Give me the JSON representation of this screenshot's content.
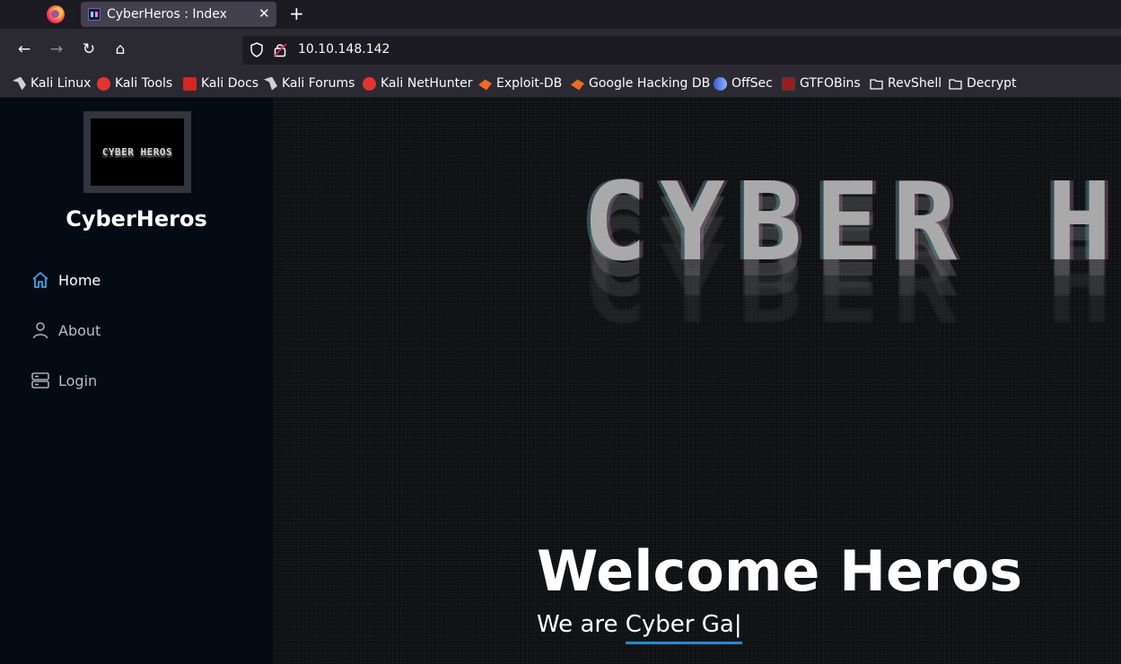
{
  "browser": {
    "tab": {
      "title": "CyberHeros : Index",
      "close_glyph": "✕"
    },
    "new_tab_glyph": "+",
    "nav": {
      "back": "←",
      "forward": "→",
      "reload": "↻",
      "home": "⌂"
    },
    "url": "10.10.148.142",
    "bookmarks": [
      {
        "label": "Kali Linux",
        "icon": "kali-dragon-icon",
        "color": "#d0d0d0"
      },
      {
        "label": "Kali Tools",
        "icon": "kali-tools-icon",
        "color": "#e5342f"
      },
      {
        "label": "Kali Docs",
        "icon": "kali-docs-icon",
        "color": "#d6261f"
      },
      {
        "label": "Kali Forums",
        "icon": "kali-forums-icon",
        "color": "#d0d0d0"
      },
      {
        "label": "Kali NetHunter",
        "icon": "kali-nethunter-icon",
        "color": "#e5342f"
      },
      {
        "label": "Exploit-DB",
        "icon": "exploit-db-icon",
        "color": "#f06a22"
      },
      {
        "label": "Google Hacking DB",
        "icon": "ghdb-icon",
        "color": "#f06a22"
      },
      {
        "label": "OffSec",
        "icon": "offsec-icon",
        "color": "#5f7fe8"
      },
      {
        "label": "GTFOBins",
        "icon": "gtfobins-icon",
        "color": "#9b1c1c"
      },
      {
        "label": "RevShell",
        "icon": "folder-icon",
        "color": "#fbfbfe"
      },
      {
        "label": "Decrypt",
        "icon": "folder-icon",
        "color": "#fbfbfe"
      }
    ]
  },
  "sidebar": {
    "logo_text": "CYBER HEROS",
    "brand": "CyberHeros",
    "items": [
      {
        "label": "Home",
        "icon": "home-icon",
        "active": true
      },
      {
        "label": "About",
        "icon": "user-icon",
        "active": false
      },
      {
        "label": "Login",
        "icon": "server-icon",
        "active": false
      }
    ]
  },
  "hero": {
    "banner_text": "CYBER H",
    "title": "Welcome Heros",
    "tagline_prefix": "We are ",
    "tagline_typed": "Cyber Ga|"
  },
  "colors": {
    "accent": "#1f8dd6",
    "home_icon": "#3ba6e6",
    "sidebar_bg": "#040b14"
  }
}
